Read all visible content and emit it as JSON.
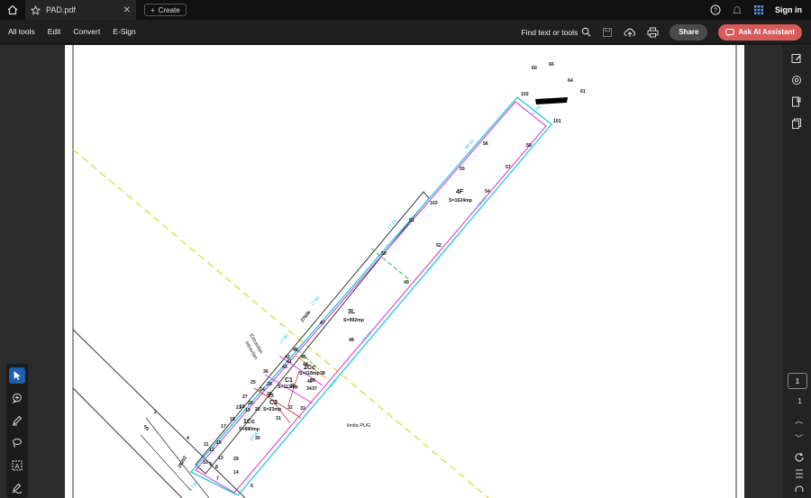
{
  "titlebar": {
    "tab_title": "PAD.pdf",
    "create_label": "Create",
    "sign_in": "Sign in"
  },
  "toolbar": {
    "menu": [
      "All tools",
      "Edit",
      "Convert",
      "E-Sign"
    ],
    "find_label": "Find text or tools",
    "share_label": "Share",
    "ai_label": "Ask AI Assistant"
  },
  "page_nav": {
    "current_page": "1",
    "total_pages": "1"
  },
  "drawing": {
    "points": [
      "60",
      "66",
      "64",
      "61",
      "102",
      "101",
      "56",
      "59",
      "55",
      "57",
      "4F",
      "S=1624mp",
      "103",
      "54",
      "51",
      "52",
      "50",
      "49",
      "3L",
      "S=992mp",
      "48",
      "47",
      "2760k",
      "46",
      "45",
      "44",
      "2Cc",
      "S=118mp",
      "43",
      "42",
      "41",
      "40",
      "39",
      "38",
      "37",
      "36",
      "C1",
      "S=113mp",
      "35",
      "34",
      "33",
      "32",
      "C2",
      "S=23mp",
      "31",
      "30",
      "1Cc",
      "S=880mp",
      "29",
      "28",
      "27",
      "26",
      "25",
      "24",
      "23",
      "22",
      "21",
      "20",
      "19",
      "18",
      "17",
      "16",
      "15",
      "14",
      "13",
      "12",
      "11",
      "10",
      "9",
      "8",
      "7",
      "6",
      "5",
      "4",
      "3",
      "2",
      "28202"
    ],
    "labels": {
      "limita_puc": "limita PUG",
      "extravilan": "Extravilan",
      "intravilan": "Intravilan"
    }
  }
}
